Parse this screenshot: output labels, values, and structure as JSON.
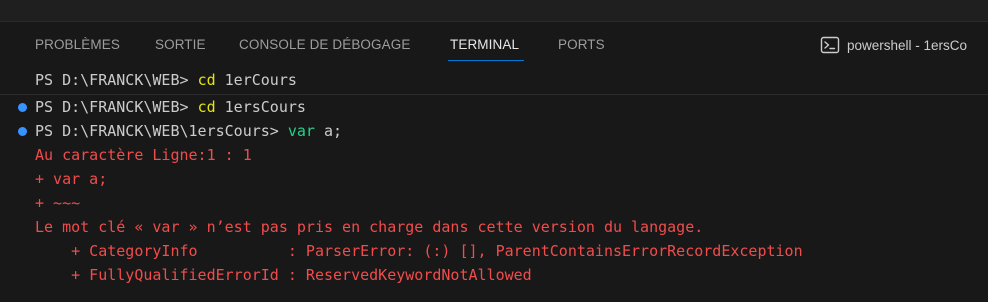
{
  "tabs": [
    {
      "label": "PROBLÈMES",
      "active": false
    },
    {
      "label": "SORTIE",
      "active": false
    },
    {
      "label": "CONSOLE DE DÉBOGAGE",
      "active": false
    },
    {
      "label": "TERMINAL",
      "active": true
    },
    {
      "label": "PORTS",
      "active": false
    }
  ],
  "shell": {
    "icon": "terminal-powershell-icon",
    "label": "powershell - 1ersCo"
  },
  "terminal": {
    "line1": {
      "prompt": "PS D:\\FRANCK\\WEB> ",
      "command": "cd",
      "args": " 1erCours"
    },
    "line2": {
      "prompt": "PS D:\\FRANCK\\WEB> ",
      "command": "cd",
      "args": " 1ersCours"
    },
    "line3": {
      "prompt": "PS D:\\FRANCK\\WEB\\1ersCours> ",
      "command": "var",
      "args": " a;"
    },
    "errors": [
      "Au caractère Ligne:1 : 1",
      "+ var a;",
      "+ ~~~",
      "Le mot clé « var » n’est pas pris en charge dans cette version du langage.",
      "    + CategoryInfo          : ParserError: (:) [], ParentContainsErrorRecordException",
      "    + FullyQualifiedErrorId : ReservedKeywordNotAllowed"
    ]
  },
  "colors": {
    "background": "#181818",
    "prompt": "#cccccc",
    "command": "#e5e510",
    "command_var": "#23d18b",
    "error": "#f14c4c",
    "decoration": "#3794ff",
    "active_tab_border": "#0078d4"
  }
}
